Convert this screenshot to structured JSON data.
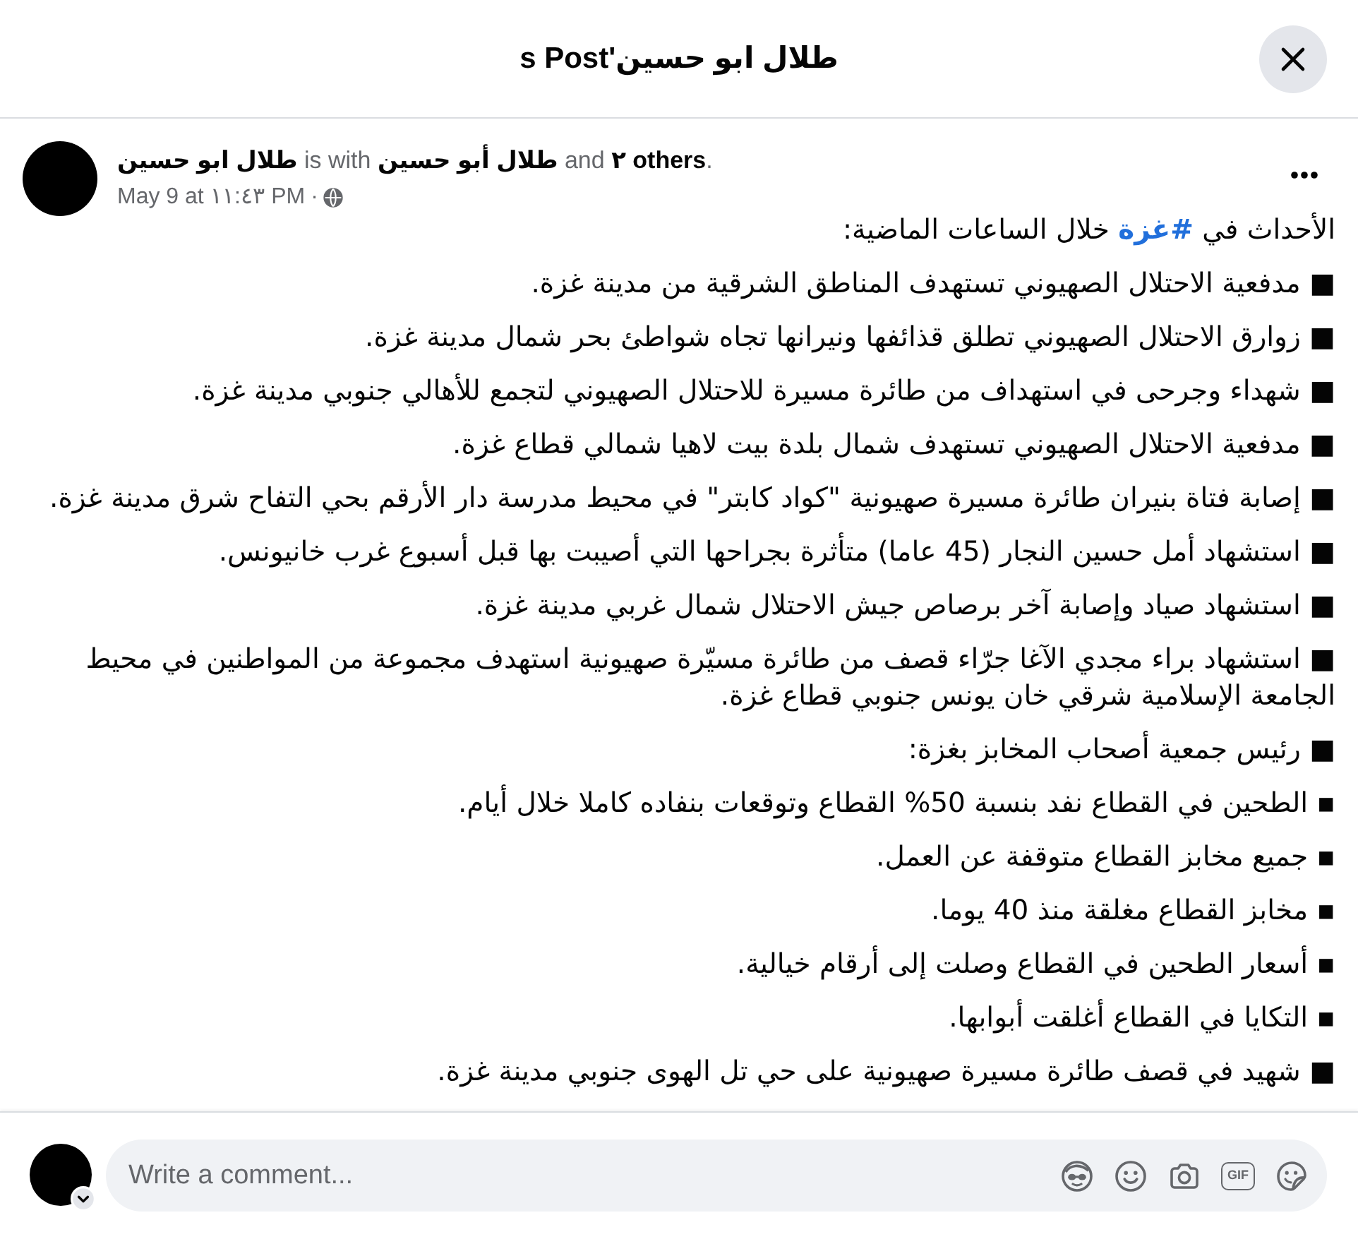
{
  "dialog": {
    "title": "طلال ابو حسين's Post"
  },
  "post": {
    "attribution": {
      "author": "طلال ابو حسين",
      "with_text": " is with ",
      "tagged_person": "طلال أبو حسين",
      "and_text": " and ",
      "others": "٢ others",
      "end_mark": "."
    },
    "timestamp": "May 9 at ١١:٤٣ PM",
    "separator": "·",
    "paragraphs": [
      {
        "segments": [
          {
            "kind": "plain",
            "text": "الأحداث في "
          },
          {
            "kind": "hashtag",
            "text": "#غزة"
          },
          {
            "kind": "plain",
            "text": " خلال الساعات الماضية:"
          }
        ]
      },
      {
        "segments": [
          {
            "kind": "plain",
            "text": "■ مدفعية الاحتلال الصهيوني تستهدف المناطق الشرقية من مدينة غزة."
          }
        ]
      },
      {
        "segments": [
          {
            "kind": "plain",
            "text": "■ زوارق الاحتلال الصهيوني تطلق قذائفها ونيرانها تجاه شواطئ بحر شمال مدينة غزة."
          }
        ]
      },
      {
        "segments": [
          {
            "kind": "plain",
            "text": "■ شهداء وجرحى في استهداف من طائرة مسيرة للاحتلال الصهيوني لتجمع للأهالي جنوبي مدينة غزة."
          }
        ]
      },
      {
        "segments": [
          {
            "kind": "plain",
            "text": "■ مدفعية الاحتلال الصهيوني تستهدف شمال بلدة بيت لاهيا شمالي قطاع غزة."
          }
        ]
      },
      {
        "segments": [
          {
            "kind": "plain",
            "text": "■ إصابة فتاة بنيران طائرة مسيرة صهيونية \"كواد كابتر\" في محيط مدرسة دار الأرقم بحي التفاح شرق مدينة غزة."
          }
        ]
      },
      {
        "segments": [
          {
            "kind": "plain",
            "text": "■ استشهاد أمل حسين النجار (45 عاما) متأثرة بجراحها التي أصيبت بها قبل أسبوع غرب خانيونس."
          }
        ]
      },
      {
        "segments": [
          {
            "kind": "plain",
            "text": "■ استشهاد صياد وإصابة آخر برصاص جيش الاحتلال شمال غربي مدينة غزة."
          }
        ]
      },
      {
        "segments": [
          {
            "kind": "plain",
            "text": "■ استشهاد براء مجدي الآغا جرّاء قصف من طائرة مسيّرة صهيونية استهدف مجموعة من المواطنين في محيط الجامعة الإسلامية شرقي خان يونس جنوبي قطاع غزة."
          }
        ]
      },
      {
        "segments": [
          {
            "kind": "plain",
            "text": "■ رئيس جمعية أصحاب المخابز بغزة:"
          }
        ]
      },
      {
        "segments": [
          {
            "kind": "plain",
            "text": "▪ الطحين في القطاع نفد بنسبة 50% القطاع وتوقعات بنفاده كاملا خلال أيام."
          }
        ]
      },
      {
        "segments": [
          {
            "kind": "plain",
            "text": "▪ جميع مخابز القطاع متوقفة عن العمل."
          }
        ]
      },
      {
        "segments": [
          {
            "kind": "plain",
            "text": "▪ مخابز القطاع مغلقة منذ 40 يوما."
          }
        ]
      },
      {
        "segments": [
          {
            "kind": "plain",
            "text": "▪ أسعار الطحين في القطاع وصلت إلى أرقام خيالية."
          }
        ]
      },
      {
        "segments": [
          {
            "kind": "plain",
            "text": "▪ التكايا في القطاع أغلقت أبوابها."
          }
        ]
      },
      {
        "segments": [
          {
            "kind": "plain",
            "text": "■ شهيد في قصف طائرة مسيرة صهيونية على حي تل الهوى جنوبي مدينة غزة."
          }
        ]
      }
    ]
  },
  "comment_box": {
    "placeholder": "Write a comment...",
    "gif_label": "GIF"
  }
}
